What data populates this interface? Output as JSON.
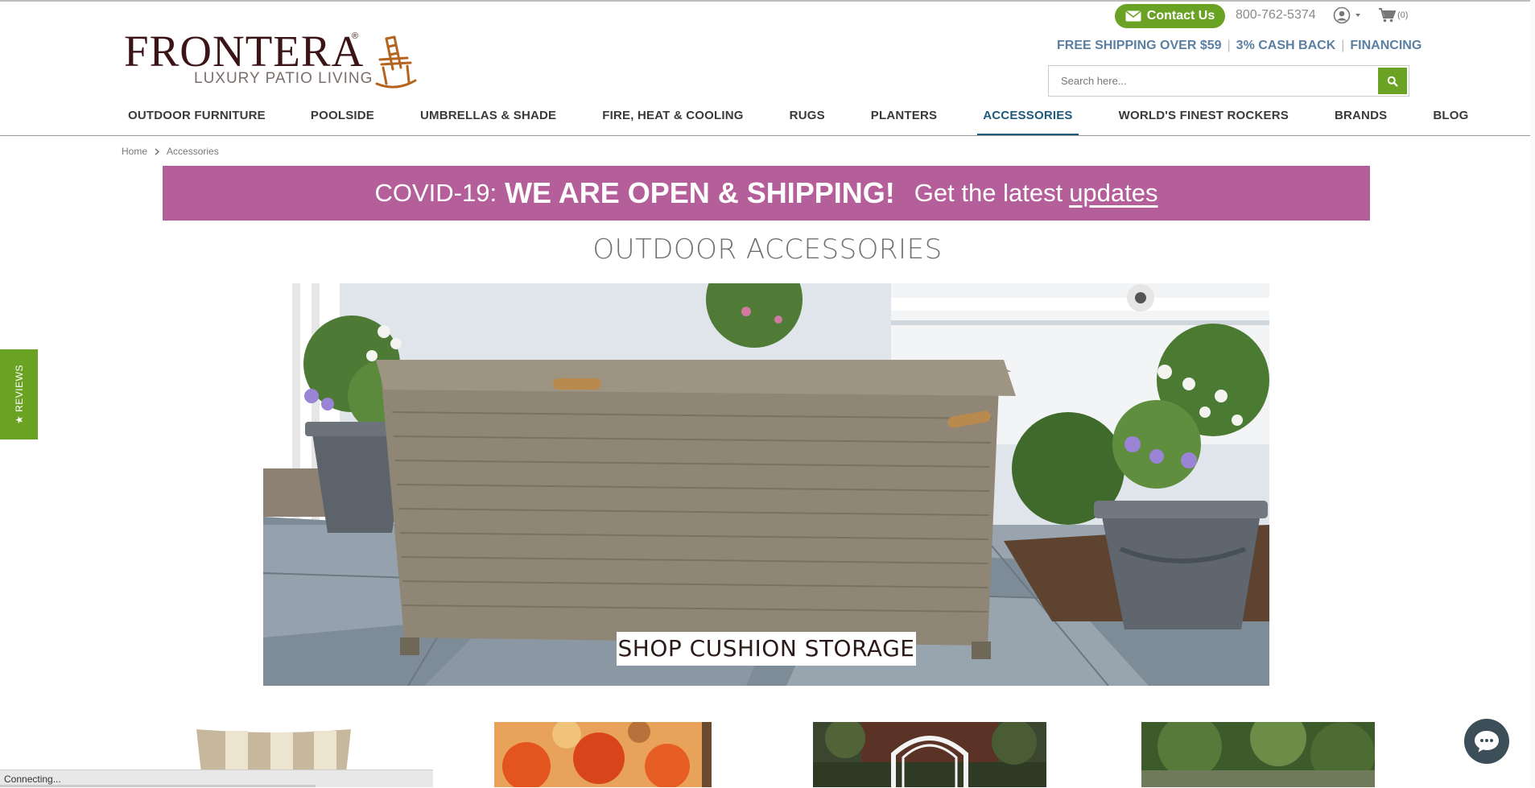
{
  "logo": {
    "brand": "FRONTERA",
    "registered": "®",
    "tagline": "LUXURY PATIO LIVING"
  },
  "header": {
    "contact_label": "Contact Us",
    "phone": "800-762-5374",
    "cart_count": "(0)",
    "promo": [
      "FREE SHIPPING OVER $59",
      "3% CASH BACK",
      "FINANCING"
    ],
    "search_placeholder": "Search here..."
  },
  "nav": {
    "items": [
      "OUTDOOR FURNITURE",
      "POOLSIDE",
      "UMBRELLAS & SHADE",
      "FIRE, HEAT & COOLING",
      "RUGS",
      "PLANTERS",
      "ACCESSORIES",
      "WORLD'S FINEST ROCKERS",
      "BRANDS",
      "BLOG"
    ],
    "active": "ACCESSORIES"
  },
  "breadcrumb": [
    "Home",
    "Accessories"
  ],
  "banner": {
    "prefix": "COVID-19:",
    "headline": "WE ARE OPEN & SHIPPING!",
    "text": "Get the latest",
    "link": "updates"
  },
  "page_title": "OUTDOOR ACCESSORIES",
  "hero": {
    "cta": "SHOP CUSHION STORAGE"
  },
  "reviews_tab": "★ REVIEWS",
  "status_bar": "Connecting...",
  "colors": {
    "accent_green": "#6aa223",
    "banner_pink": "#b45e9a",
    "nav_active": "#1d5a7c",
    "logo_brown": "#3a1416"
  },
  "icons": [
    "envelope-icon",
    "user-icon",
    "cart-icon",
    "search-icon",
    "chat-icon",
    "chevron-right-icon",
    "caret-down-icon"
  ]
}
